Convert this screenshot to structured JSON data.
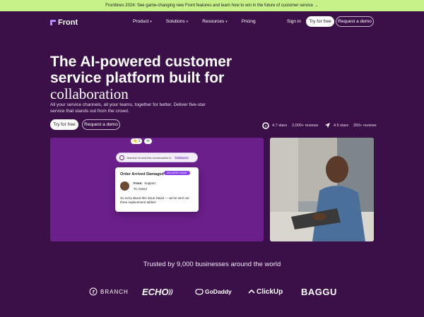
{
  "banner": {
    "text": "Frontlines 2024: See game-changing new Front features and learn how to win in the future of customer service →"
  },
  "nav": {
    "logo_text": "Front",
    "links": [
      "Product",
      "Solutions",
      "Resources",
      "Pricing"
    ],
    "signin": "Sign in",
    "try_free": "Try for free",
    "request_demo": "Request a demo"
  },
  "hero": {
    "title_line1": "The AI-powered customer",
    "title_line2": "service platform built for",
    "title_line3": "collaboration",
    "subtitle": "All your service channels, all your teams, together for better. Deliver five-star service that stands out from the crowd.",
    "try_free": "Try for free",
    "request_demo": "Request a demo"
  },
  "ratings": {
    "g2": {
      "stars": "4.7 stars",
      "reviews": "2,000+ reviews"
    },
    "capterra": {
      "stars": "4.5 stars",
      "reviews": "250+ reviews"
    }
  },
  "demo_card": {
    "pill1": "1",
    "notice": "Jasmine moved this conversation to",
    "notice_target": "Fulfillment",
    "title": "Order Arrived Damaged",
    "tag": "DELIVERY ISSUE",
    "from_label": "From:",
    "from_value": "Support",
    "to_value": "To: David",
    "message": "So sorry about this issue David — we've sent out three replacement tables!"
  },
  "trusted": {
    "text": "Trusted by 9,000 businesses around the world",
    "logos": [
      "BRANCH",
      "ECHO",
      "GoDaddy",
      "ClickUp",
      "BAGGU"
    ]
  },
  "colors": {
    "background": "#3b1048",
    "banner": "#c7f28a",
    "accent": "#8a3ee8"
  }
}
